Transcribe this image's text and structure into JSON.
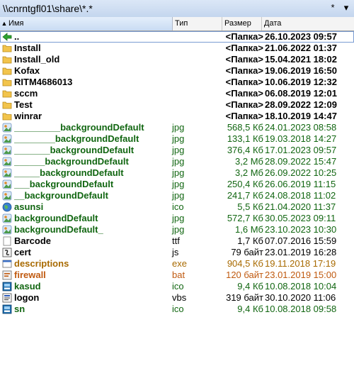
{
  "path": {
    "text": "\\\\cnrntgfl01\\share\\*.*",
    "star_button": "*",
    "menu_button": "▾"
  },
  "columns": {
    "name": "Имя",
    "type": "Тип",
    "size": "Размер",
    "date": "Дата"
  },
  "colors": {
    "default_text": "#000000",
    "image_text": "#116611",
    "exe_text": "#a86a00",
    "bat_text": "#c05a10",
    "vbs_text": "#000000",
    "selection_border": "#7a9cd3",
    "folder_icon": "#f2c44c"
  },
  "rows": [
    {
      "name": "..",
      "type": "",
      "size": "<Папка>",
      "date": "26.10.2023 09:57",
      "icon": "up-arrow-icon",
      "kind": "up",
      "color": "#000000",
      "selected": true
    },
    {
      "name": "Install",
      "type": "",
      "size": "<Папка>",
      "date": "21.06.2022 01:37",
      "icon": "folder-icon",
      "kind": "folder",
      "color": "#000000"
    },
    {
      "name": "Install_old",
      "type": "",
      "size": "<Папка>",
      "date": "15.04.2021 18:02",
      "icon": "folder-icon",
      "kind": "folder",
      "color": "#000000"
    },
    {
      "name": "Kofax",
      "type": "",
      "size": "<Папка>",
      "date": "19.06.2019 16:50",
      "icon": "folder-icon",
      "kind": "folder",
      "color": "#000000"
    },
    {
      "name": "RITM4686013",
      "type": "",
      "size": "<Папка>",
      "date": "10.06.2019 12:32",
      "icon": "folder-icon",
      "kind": "folder",
      "color": "#000000"
    },
    {
      "name": "sccm",
      "type": "",
      "size": "<Папка>",
      "date": "06.08.2019 12:01",
      "icon": "folder-icon",
      "kind": "folder",
      "color": "#000000"
    },
    {
      "name": "Test",
      "type": "",
      "size": "<Папка>",
      "date": "28.09.2022 12:09",
      "icon": "folder-icon",
      "kind": "folder",
      "color": "#000000"
    },
    {
      "name": "winrar",
      "type": "",
      "size": "<Папка>",
      "date": "18.10.2019 14:47",
      "icon": "folder-icon",
      "kind": "folder",
      "color": "#000000"
    },
    {
      "name": "_________backgroundDefault",
      "type": "jpg",
      "size": "568,5 Кб",
      "date": "24.01.2023 08:58",
      "icon": "image-file-icon",
      "kind": "image",
      "color": "#116611"
    },
    {
      "name": "________backgroundDefault",
      "type": "jpg",
      "size": "133,1 Кб",
      "date": "19.03.2018 14:27",
      "icon": "image-file-icon",
      "kind": "image",
      "color": "#116611"
    },
    {
      "name": "_______backgroundDefault",
      "type": "jpg",
      "size": "376,4 Кб",
      "date": "17.01.2023 09:57",
      "icon": "image-file-icon",
      "kind": "image",
      "color": "#116611"
    },
    {
      "name": "______backgroundDefault",
      "type": "jpg",
      "size": "3,2 Мб",
      "date": "28.09.2022 15:47",
      "icon": "image-file-icon",
      "kind": "image",
      "color": "#116611"
    },
    {
      "name": "_____backgroundDefault",
      "type": "jpg",
      "size": "3,2 Мб",
      "date": "26.09.2022 10:25",
      "icon": "image-file-icon",
      "kind": "image",
      "color": "#116611"
    },
    {
      "name": "___backgroundDefault",
      "type": "jpg",
      "size": "250,4 Кб",
      "date": "26.06.2019 11:15",
      "icon": "image-file-icon",
      "kind": "image",
      "color": "#116611"
    },
    {
      "name": "__backgroundDefault",
      "type": "jpg",
      "size": "241,7 Кб",
      "date": "24.08.2018 11:02",
      "icon": "image-file-icon",
      "kind": "image",
      "color": "#116611"
    },
    {
      "name": "asunsi",
      "type": "ico",
      "size": "5,5 Кб",
      "date": "21.04.2020 11:37",
      "icon": "globe-icon",
      "kind": "image",
      "color": "#116611"
    },
    {
      "name": "backgroundDefault",
      "type": "jpg",
      "size": "572,7 Кб",
      "date": "30.05.2023 09:11",
      "icon": "image-file-icon",
      "kind": "image",
      "color": "#116611"
    },
    {
      "name": "backgroundDefault_",
      "type": "jpg",
      "size": "1,6 Мб",
      "date": "23.10.2023 10:30",
      "icon": "image-file-icon",
      "kind": "image",
      "color": "#116611"
    },
    {
      "name": "Barcode",
      "type": "ttf",
      "size": "1,7 Кб",
      "date": "07.07.2016 15:59",
      "icon": "font-file-icon",
      "kind": "plain",
      "color": "#000000"
    },
    {
      "name": "cert",
      "type": "js",
      "size": "79 байт",
      "date": "23.01.2019 16:28",
      "icon": "script-file-icon",
      "kind": "plain",
      "color": "#000000"
    },
    {
      "name": "descriptions",
      "type": "exe",
      "size": "904,5 Кб",
      "date": "19.11.2018 17:19",
      "icon": "exe-file-icon",
      "kind": "exe",
      "color": "#a86a00"
    },
    {
      "name": "firewall",
      "type": "bat",
      "size": "120 байт",
      "date": "23.01.2019 15:00",
      "icon": "batch-file-icon",
      "kind": "bat",
      "color": "#c05a10"
    },
    {
      "name": "kasud",
      "type": "ico",
      "size": "9,4 Кб",
      "date": "10.08.2018 10:04",
      "icon": "app-ico-icon",
      "kind": "image",
      "color": "#116611"
    },
    {
      "name": "logon",
      "type": "vbs",
      "size": "319 байт",
      "date": "30.10.2020 11:06",
      "icon": "vbs-file-icon",
      "kind": "plain",
      "color": "#000000"
    },
    {
      "name": "sn",
      "type": "ico",
      "size": "9,4 Кб",
      "date": "10.08.2018 09:58",
      "icon": "app-ico-icon",
      "kind": "image",
      "color": "#116611"
    }
  ]
}
